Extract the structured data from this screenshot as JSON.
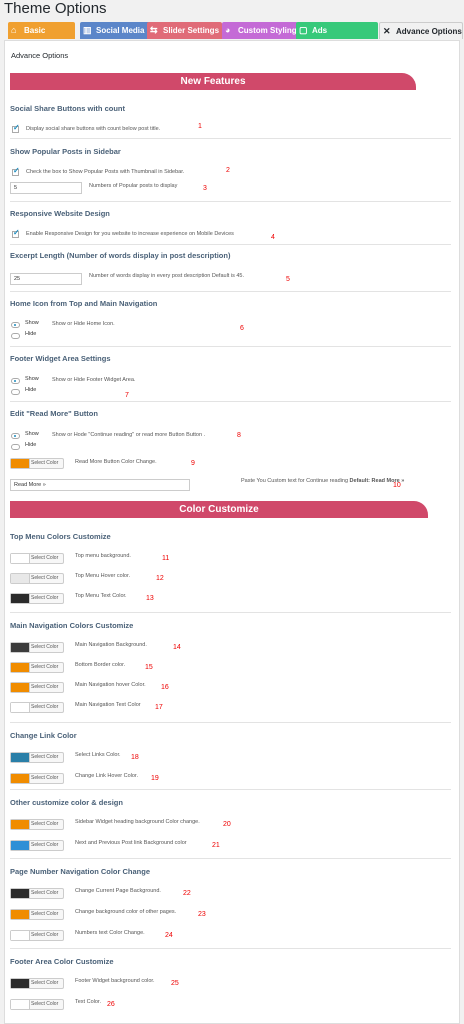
{
  "title": "Theme Options",
  "tabs": [
    {
      "label": "Basic Settings",
      "icon": "home-icon",
      "color": "#f0a030"
    },
    {
      "label": "Social Media",
      "icon": "chart-icon",
      "color": "#5b86c9"
    },
    {
      "label": "Slider Settings",
      "icon": "slider-icon",
      "color": "#e06b78"
    },
    {
      "label": "Custom Styling",
      "icon": "palette-icon",
      "color": "#c46ad6"
    },
    {
      "label": "Ads Management",
      "icon": "ads-icon",
      "color": "#37c97a"
    },
    {
      "label": "Advance Options",
      "icon": "wrench-icon",
      "active": true
    }
  ],
  "subheading": "Advance Options",
  "banners": {
    "features": "New Features",
    "colors": "Color Customize"
  },
  "features": {
    "share": {
      "title": "Social Share Buttons with count",
      "label": "Display social share buttons with count below post title.",
      "num": "1"
    },
    "popular": {
      "title": "Show Popular Posts in Sidebar",
      "label": "Check the box to Show Popular Posts with Thumbnail in Sidebar.",
      "num": "2",
      "count_value": "5",
      "count_label": "Numbers of Popular posts to display",
      "count_num": "3"
    },
    "responsive": {
      "title": "Responsive Website Design",
      "label": "Enable Responsive Design for you website to increase experience on Mobile Devices",
      "num": "4"
    },
    "excerpt": {
      "title": "Excerpt Length (Number of words display in post description)",
      "value": "25",
      "label": "Number of words display in every post description Default is 45.",
      "num": "5"
    },
    "home_icon": {
      "title": "Home Icon from Top and Main Navigation",
      "show": "Show",
      "hide": "Hide",
      "label": "Show or Hide Home Icon.",
      "num": "6"
    },
    "footer_widget": {
      "title": "Footer Widget Area Settings",
      "show": "Show",
      "hide": "Hide",
      "label": "Show or Hide Footer Widget Area.",
      "num": "7"
    },
    "read_more": {
      "title": "Edit \"Read More\" Button",
      "show": "Show",
      "hide": "Hide",
      "label": "Show or Hode \"Continue reading\" or read more Button Button .",
      "num": "8",
      "color_label": "Read More Button Color Change.",
      "color_num": "9",
      "text_value": "Read More »",
      "text_label": "Paste You Custom text for Continue reading",
      "text_default": "Default: Read More »",
      "text_num": "10"
    }
  },
  "select_color": "Select Color",
  "color_sections": [
    {
      "title": "Top Menu Colors Customize",
      "items": [
        {
          "label": "Top menu background.",
          "num": "11",
          "color": "#ffffff"
        },
        {
          "label": "Top Menu Hover color.",
          "num": "12",
          "color": "#e8e8e8"
        },
        {
          "label": "Top Menu Text Color.",
          "num": "13",
          "color": "#2b2b2b"
        }
      ]
    },
    {
      "title": "Main Navigation Colors Customize",
      "items": [
        {
          "label": "Main Navigation Background.",
          "num": "14",
          "color": "#3c3c3c"
        },
        {
          "label": "Bottom Border color.",
          "num": "15",
          "color": "#f08c00"
        },
        {
          "label": "Main Navigation hover Color.",
          "num": "16",
          "color": "#f08c00"
        },
        {
          "label": "Main Navigation Text Color",
          "num": "17",
          "color": "#ffffff"
        }
      ]
    },
    {
      "title": "Change Link Color",
      "items": [
        {
          "label": "Select Links Color.",
          "num": "18",
          "color": "#2a7fa8"
        },
        {
          "label": "Change Link Hover Color.",
          "num": "19",
          "color": "#f08c00"
        }
      ]
    },
    {
      "title": "Other customize color & design",
      "items": [
        {
          "label": "Sidebar Widget heading background Color change.",
          "num": "20",
          "color": "#f08c00"
        },
        {
          "label": "Next and Previous Post link Background color",
          "num": "21",
          "color": "#2e8fd6"
        }
      ]
    },
    {
      "title": "Page Number Navigation Color Change",
      "items": [
        {
          "label": "Change Current Page Background.",
          "num": "22",
          "color": "#2b2b2b"
        },
        {
          "label": "Change background color of other pages.",
          "num": "23",
          "color": "#f08c00"
        },
        {
          "label": "Numbers text Color Change.",
          "num": "24",
          "color": "#ffffff"
        }
      ]
    },
    {
      "title": "Footer Area Color Customize",
      "items": [
        {
          "label": "Footer Widget background color.",
          "num": "25",
          "color": "#2b2b2b"
        },
        {
          "label": "Text Color.",
          "num": "26",
          "color": "#ffffff"
        }
      ]
    }
  ]
}
